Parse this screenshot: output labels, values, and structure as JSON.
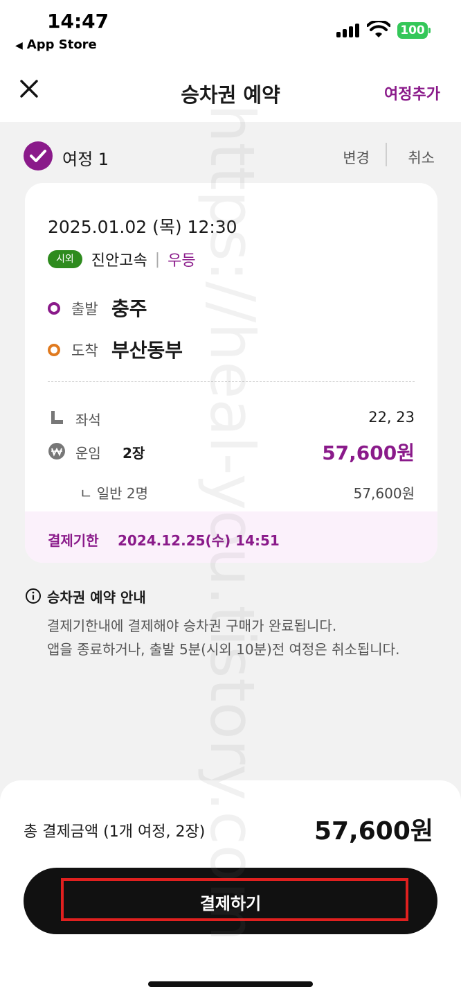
{
  "status_bar": {
    "time": "14:47",
    "back_app": "App Store",
    "battery": "100",
    "battery_color": "#34c759"
  },
  "header": {
    "title": "승차권 예약",
    "close_icon": "close-icon",
    "add_trip": "여정추가"
  },
  "trip": {
    "label": "여정 1",
    "change": "변경",
    "cancel": "취소",
    "date": "2025.01.02 (목) 12:30",
    "badge": "시외",
    "company": "진안고속",
    "separator": "|",
    "grade": "우등",
    "departure_label": "출발",
    "departure": "충주",
    "arrival_label": "도착",
    "arrival": "부산동부",
    "seat_label": "좌석",
    "seats": "22, 23",
    "fare_label": "운임",
    "ticket_count": "2장",
    "fare": "57,600원",
    "sub_label": "ㄴ 일반 2명",
    "sub_fare": "57,600원",
    "deadline_label": "결제기한",
    "deadline": "2024.12.25(수) 14:51"
  },
  "notice": {
    "title": "승차권 예약 안내",
    "line1": "결제기한내에 결제해야 승차권 구매가 완료됩니다.",
    "line2": "앱을 종료하거나, 출발 5분(시외 10분)전 여정은 취소됩니다."
  },
  "footer": {
    "total_label": "총 결제금액 (1개 여정, 2장)",
    "total": "57,600원",
    "pay_button": "결제하기"
  },
  "watermark": "https://heal-you.tistory.com",
  "colors": {
    "accent": "#8a1a8a",
    "arrival_dot": "#e07a1f",
    "badge": "#2e8b1e",
    "highlight_box": "#e0201f"
  }
}
